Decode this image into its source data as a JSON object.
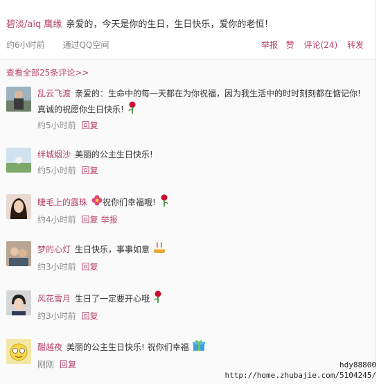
{
  "post": {
    "author": "碧淡/aiq 鹰缘",
    "text": "亲爱的，今天是你的生日，生日快乐，爱你的老恒！",
    "time": "约6小时前",
    "source": "通过QQ空间",
    "actions": {
      "report": "举报",
      "like": "赞",
      "comments": "评论(24)",
      "forward": "转发"
    }
  },
  "view_all": "查看全部25条评论>>",
  "comments": [
    {
      "name": "乱云飞渡",
      "text": "亲爱的：生命中的每一天都在为你祝福，因为我生活中的时时刻刻都在惦记你!",
      "text2": "真诚的祝愿你生日快乐!",
      "emoji": "rose-icon",
      "time": "约5小时前",
      "reply": "回复",
      "report": ""
    },
    {
      "name": "绊城烟沙",
      "text": "美丽的公主生日快乐!",
      "text2": "",
      "emoji": "",
      "time": "约5小时前",
      "reply": "回复",
      "report": ""
    },
    {
      "name": "睫毛上的露珠",
      "text": "祝你们幸福哦!",
      "text2": "",
      "emoji": "rose-icon",
      "time": "约4小时前",
      "reply": "回复",
      "report": "举报"
    },
    {
      "name": "梦的心灯",
      "text": "生日快乐，事事如意",
      "text2": "",
      "emoji": "cake-icon",
      "time": "约3小时前",
      "reply": "回复",
      "report": ""
    },
    {
      "name": "风花雪月",
      "text": "生日了一定要开心哦",
      "text2": "",
      "emoji": "rose-icon",
      "time": "约3小时前",
      "reply": "回复",
      "report": ""
    },
    {
      "name": "酣越夜",
      "text": "美丽的公主生日快乐! 祝你们幸福",
      "text2": "",
      "emoji": "gift-icon",
      "time": "刚刚",
      "reply": "回复",
      "report": ""
    }
  ],
  "watermark": {
    "line1": "hdy88800",
    "line2": "http://home.zhubajie.com/5104245/"
  },
  "colors": {
    "accent": "#b7446b",
    "meta": "#888888"
  }
}
